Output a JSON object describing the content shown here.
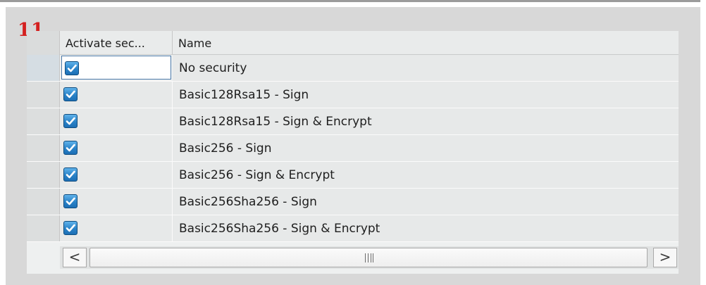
{
  "step_number": "11",
  "table": {
    "columns": [
      "Activate sec...",
      "Name"
    ],
    "rows": [
      {
        "activate": true,
        "name": "No security"
      },
      {
        "activate": true,
        "name": "Basic128Rsa15 - Sign"
      },
      {
        "activate": true,
        "name": "Basic128Rsa15 - Sign & Encrypt"
      },
      {
        "activate": true,
        "name": "Basic256 - Sign"
      },
      {
        "activate": true,
        "name": "Basic256 - Sign & Encrypt"
      },
      {
        "activate": true,
        "name": "Basic256Sha256 - Sign"
      },
      {
        "activate": true,
        "name": "Basic256Sha256 - Sign & Encrypt"
      }
    ]
  },
  "scrollbar": {
    "left_arrow": "<",
    "right_arrow": ">",
    "grip_icon": "grip-lines-icon"
  },
  "colors": {
    "step_number": "#d4201f",
    "checkbox_fill": "#2a83c8",
    "panel_bg": "#d8d8d8",
    "cell_bg": "#e7e9e9"
  }
}
